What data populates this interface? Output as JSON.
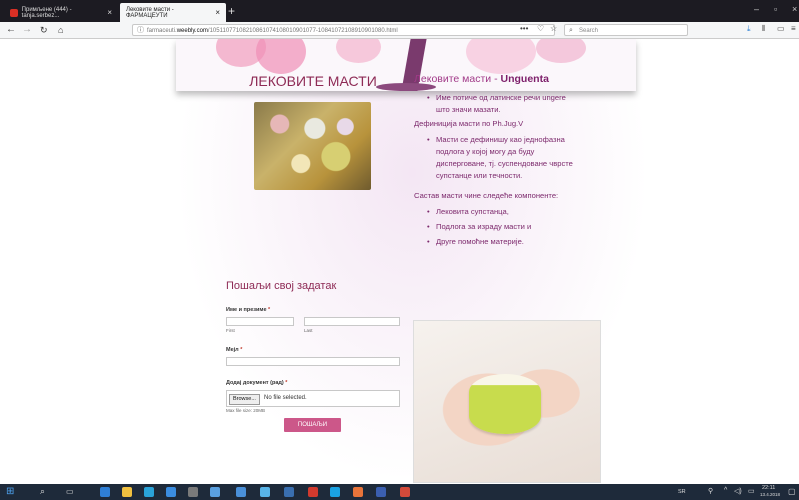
{
  "browser": {
    "tabs": [
      {
        "label": "Примљене (444) - tanja.serbez...",
        "active": false
      },
      {
        "label": "Лековите масти - ФАРМАЦЕУТИ",
        "active": true
      }
    ],
    "url_prefix": "farmaceuti.",
    "url_domain": "weebly.com",
    "url_path": "/10511077108210861074108010901077-10841072108910901080.html",
    "search_placeholder": "Search"
  },
  "page": {
    "left_heading": "ЛЕКОВИТЕ МАСТИ",
    "right_title_prefix": "Лековите масти - ",
    "right_title_bold": "Unguenta",
    "list1": [
      "Име потиче од латинске речи ungere",
      "што значи мазати."
    ],
    "definition_line": "Дефиниција масти по Ph.Jug.V",
    "list2": [
      "Масти се дефинишу као једнофазна",
      "подлога у којој могу да буду",
      "дисперговане, тј. суспендоване чврсте",
      "супстанце или течности."
    ],
    "composition_line": "Састав масти чине следеће компоненте:",
    "list3": [
      "Лековита супстанца,",
      "Подлога за израду масти и",
      "Друге помоћне материје."
    ]
  },
  "form": {
    "title": "Пошаљи свој задатак",
    "name_label": "Име и презиме",
    "first_sub": "First",
    "last_sub": "Last",
    "email_label": "Мејл",
    "file_label": "Додај документ (рад)",
    "required_mark": "*",
    "browse_label": "Browse...",
    "no_file": "No file selected.",
    "max_size": "Max file size: 20MB",
    "submit_label": "ПОШАЉИ"
  },
  "taskbar": {
    "time": "22:11",
    "date": "13.4.2018",
    "lang": "SR"
  },
  "colors": {
    "accent": "#8e2a55",
    "text_purple": "#7d2a6d",
    "button": "#cc5789"
  }
}
